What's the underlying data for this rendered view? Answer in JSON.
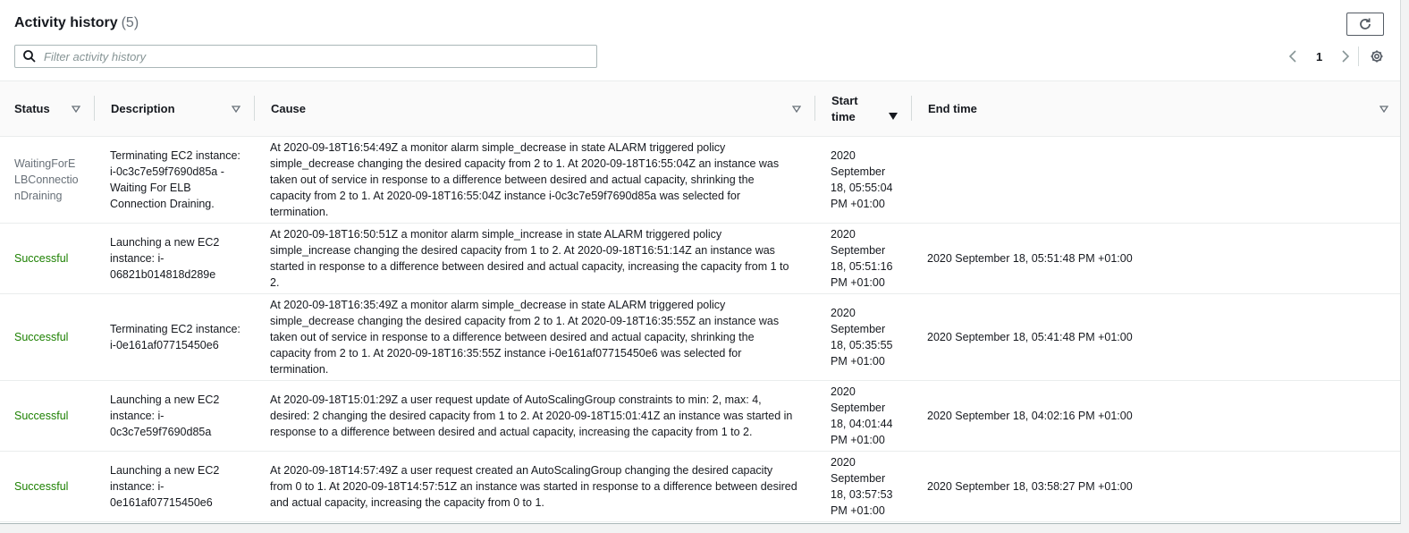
{
  "header": {
    "title": "Activity history",
    "count": "(5)"
  },
  "search": {
    "placeholder": "Filter activity history"
  },
  "pagination": {
    "current_page": "1"
  },
  "columns": {
    "status": "Status",
    "description": "Description",
    "cause": "Cause",
    "start_time": "Start time",
    "end_time": "End time"
  },
  "rows": [
    {
      "status": "WaitingForELBConnectionDraining",
      "status_type": "waiting",
      "description": "Terminating EC2 instance: i-0c3c7e59f7690d85a - Waiting For ELB Connection Draining.",
      "cause": "At 2020-09-18T16:54:49Z a monitor alarm simple_decrease in state ALARM triggered policy simple_decrease changing the desired capacity from 2 to 1. At 2020-09-18T16:55:04Z an instance was taken out of service in response to a difference between desired and actual capacity, shrinking the capacity from 2 to 1. At 2020-09-18T16:55:04Z instance i-0c3c7e59f7690d85a was selected for termination.",
      "start_time": "2020 September 18, 05:55:04 PM +01:00",
      "end_time": ""
    },
    {
      "status": "Successful",
      "status_type": "success",
      "description": "Launching a new EC2 instance: i-06821b014818d289e",
      "cause": "At 2020-09-18T16:50:51Z a monitor alarm simple_increase in state ALARM triggered policy simple_increase changing the desired capacity from 1 to 2. At 2020-09-18T16:51:14Z an instance was started in response to a difference between desired and actual capacity, increasing the capacity from 1 to 2.",
      "start_time": "2020 September 18, 05:51:16 PM +01:00",
      "end_time": "2020 September 18, 05:51:48 PM +01:00"
    },
    {
      "status": "Successful",
      "status_type": "success",
      "description": "Terminating EC2 instance: i-0e161af07715450e6",
      "cause": "At 2020-09-18T16:35:49Z a monitor alarm simple_decrease in state ALARM triggered policy simple_decrease changing the desired capacity from 2 to 1. At 2020-09-18T16:35:55Z an instance was taken out of service in response to a difference between desired and actual capacity, shrinking the capacity from 2 to 1. At 2020-09-18T16:35:55Z instance i-0e161af07715450e6 was selected for termination.",
      "start_time": "2020 September 18, 05:35:55 PM +01:00",
      "end_time": "2020 September 18, 05:41:48 PM +01:00"
    },
    {
      "status": "Successful",
      "status_type": "success",
      "description": "Launching a new EC2 instance: i-0c3c7e59f7690d85a",
      "cause": "At 2020-09-18T15:01:29Z a user request update of AutoScalingGroup constraints to min: 2, max: 4, desired: 2 changing the desired capacity from 1 to 2. At 2020-09-18T15:01:41Z an instance was started in response to a difference between desired and actual capacity, increasing the capacity from 1 to 2.",
      "start_time": "2020 September 18, 04:01:44 PM +01:00",
      "end_time": "2020 September 18, 04:02:16 PM +01:00"
    },
    {
      "status": "Successful",
      "status_type": "success",
      "description": "Launching a new EC2 instance: i-0e161af07715450e6",
      "cause": "At 2020-09-18T14:57:49Z a user request created an AutoScalingGroup changing the desired capacity from 0 to 1. At 2020-09-18T14:57:51Z an instance was started in response to a difference between desired and actual capacity, increasing the capacity from 0 to 1.",
      "start_time": "2020 September 18, 03:57:53 PM +01:00",
      "end_time": "2020 September 18, 03:58:27 PM +01:00"
    }
  ],
  "colors": {
    "success": "#1d8102",
    "waiting": "#687078",
    "border": "#eaeded"
  },
  "icons": {
    "refresh": "refresh-icon",
    "search": "search-icon",
    "prev": "chevron-left-icon",
    "next": "chevron-right-icon",
    "settings": "gear-icon",
    "sort": "sort-triangle-icon"
  }
}
